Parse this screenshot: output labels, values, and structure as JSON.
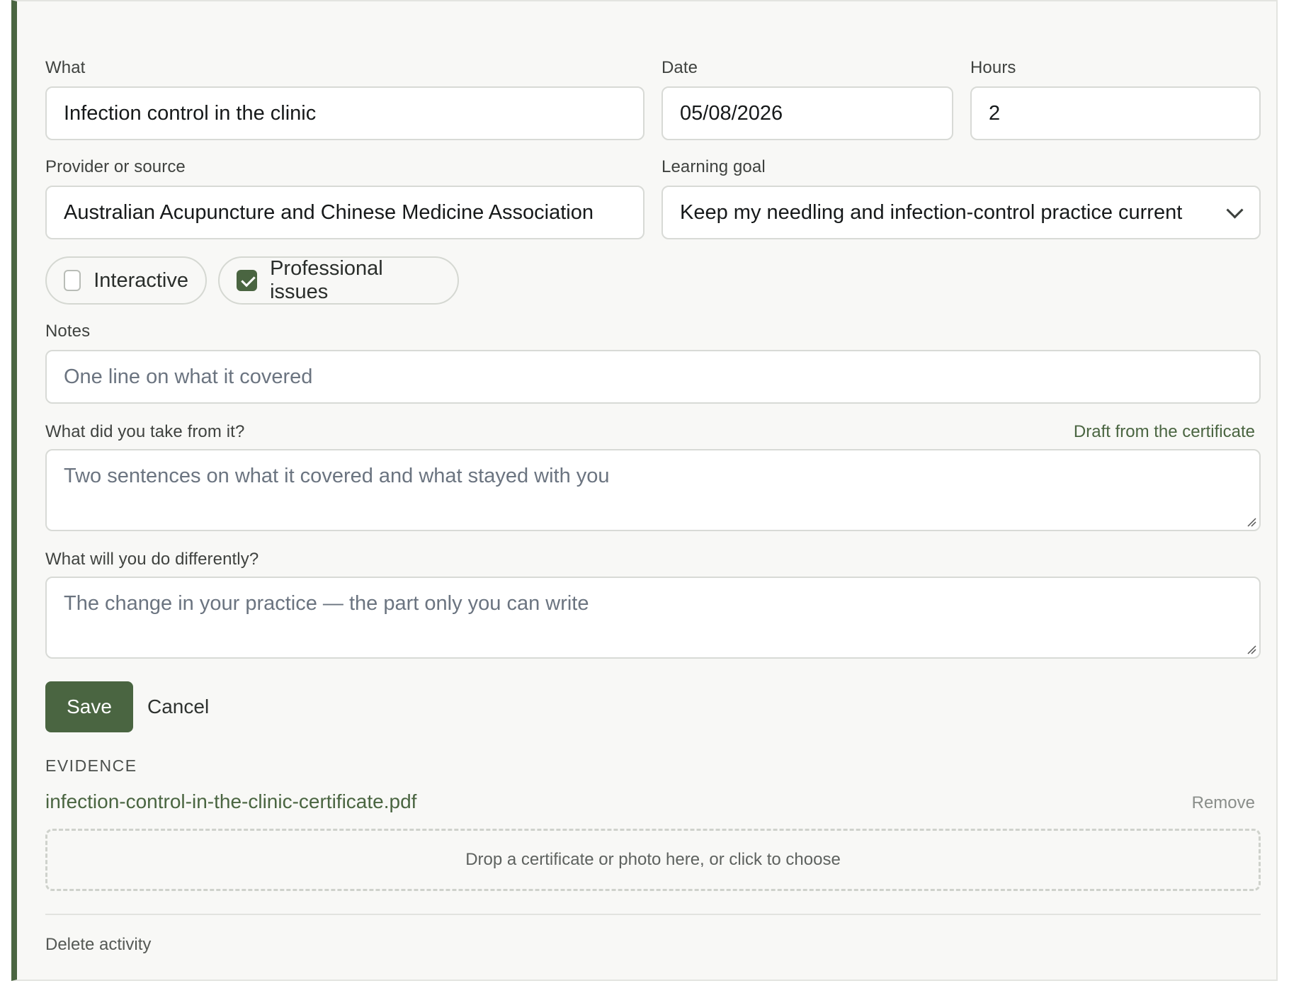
{
  "form": {
    "what": {
      "label": "What",
      "value": "Infection control in the clinic"
    },
    "date": {
      "label": "Date",
      "value": "05/08/2026"
    },
    "hours": {
      "label": "Hours",
      "value": "2"
    },
    "provider": {
      "label": "Provider or source",
      "value": "Australian Acupuncture and Chinese Medicine Association"
    },
    "learning_goal": {
      "label": "Learning goal",
      "value": "Keep my needling and infection-control practice current"
    },
    "toggles": [
      {
        "label": "Interactive",
        "checked": false
      },
      {
        "label": "Professional issues",
        "checked": true
      }
    ],
    "notes": {
      "label": "Notes",
      "placeholder": "One line on what it covered"
    },
    "takeaway": {
      "label": "What did you take from it?",
      "placeholder": "Two sentences on what it covered and what stayed with you",
      "draft_link": "Draft from the certificate"
    },
    "change": {
      "label": "What will you do differently?",
      "placeholder": "The change in your practice — the part only you can write"
    }
  },
  "actions": {
    "save_label": "Save",
    "cancel_label": "Cancel"
  },
  "evidence": {
    "title": "EVIDENCE",
    "file_name": "infection-control-in-the-clinic-certificate.pdf",
    "remove_label": "Remove",
    "dropzone_text": "Drop a certificate or photo here, or click to choose"
  },
  "delete_label": "Delete activity",
  "colors": {
    "accent": "#4a6541",
    "background": "#f8f8f6",
    "border": "#d8dad6"
  }
}
